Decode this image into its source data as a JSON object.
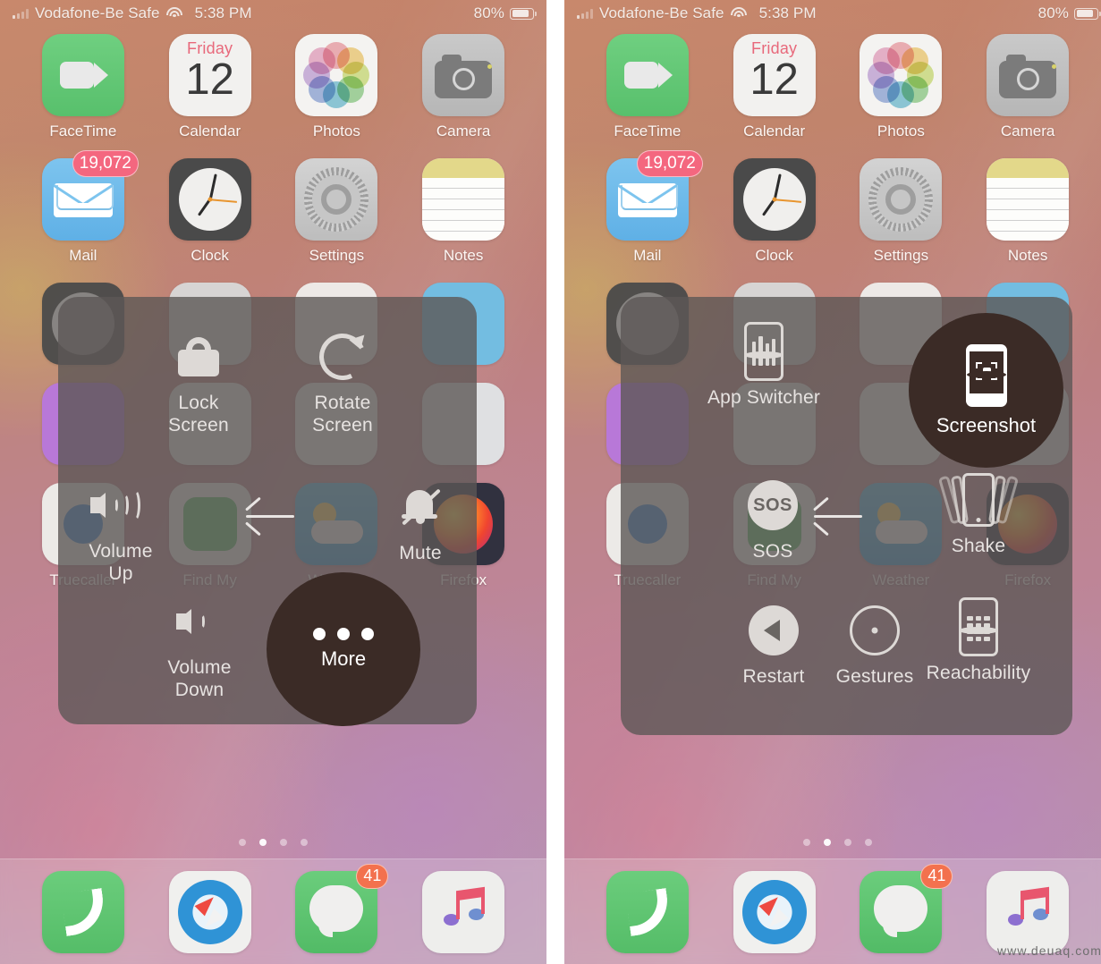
{
  "status_bar": {
    "carrier": "Vodafone-Be Safe",
    "time": "5:38 PM",
    "battery_percent": "80%",
    "wifi_icon": "wifi-icon",
    "signal_icon": "cellular-signal-icon",
    "battery_icon": "battery-icon"
  },
  "home_screen": {
    "apps_row1": [
      {
        "label": "FaceTime",
        "icon": "facetime-icon"
      },
      {
        "label": "Calendar",
        "icon": "calendar-icon",
        "day_of_week": "Friday",
        "day_number": "12"
      },
      {
        "label": "Photos",
        "icon": "photos-icon"
      },
      {
        "label": "Camera",
        "icon": "camera-icon"
      }
    ],
    "apps_row2": [
      {
        "label": "Mail",
        "icon": "mail-icon",
        "badge": "19,072"
      },
      {
        "label": "Clock",
        "icon": "clock-icon"
      },
      {
        "label": "Settings",
        "icon": "settings-icon"
      },
      {
        "label": "Notes",
        "icon": "notes-icon"
      }
    ],
    "apps_row5": [
      {
        "label": "Truecaller",
        "icon": "truecaller-icon"
      },
      {
        "label": "Find My",
        "icon": "find-my-icon"
      },
      {
        "label": "Weather",
        "icon": "weather-icon"
      },
      {
        "label": "Firefox",
        "icon": "firefox-icon"
      }
    ],
    "page_dots": {
      "count": 4,
      "active_index": 1
    },
    "dock": [
      {
        "label": "Phone",
        "icon": "phone-icon"
      },
      {
        "label": "Safari",
        "icon": "safari-icon"
      },
      {
        "label": "Messages",
        "icon": "messages-icon",
        "badge": "41"
      },
      {
        "label": "Music",
        "icon": "music-icon"
      }
    ]
  },
  "left_panel": {
    "items": [
      {
        "label": "Lock Screen",
        "line1": "Lock",
        "line2": "Screen",
        "icon": "lock-icon"
      },
      {
        "label": "Rotate Screen",
        "line1": "Rotate",
        "line2": "Screen",
        "icon": "rotate-icon"
      },
      {
        "label": "Volume Up",
        "line1": "Volume",
        "line2": "Up",
        "icon": "volume-up-icon"
      },
      {
        "label": "Mute",
        "line1": "Mute",
        "line2": "",
        "icon": "mute-bell-icon"
      },
      {
        "label": "Volume Down",
        "line1": "Volume",
        "line2": "Down",
        "icon": "volume-down-icon"
      }
    ],
    "back_icon": "back-arrow-icon",
    "highlight": {
      "label": "More",
      "icon": "ellipsis-icon",
      "color": "#3b2b26"
    }
  },
  "right_panel": {
    "items": [
      {
        "label": "App Switcher",
        "icon": "app-switcher-icon"
      },
      {
        "label": "SOS",
        "icon": "sos-icon",
        "glyph_text": "SOS"
      },
      {
        "label": "Shake",
        "icon": "shake-icon"
      },
      {
        "label": "Restart",
        "icon": "restart-icon"
      },
      {
        "label": "Gestures",
        "icon": "gestures-icon"
      },
      {
        "label": "Reachability",
        "icon": "reachability-icon"
      }
    ],
    "back_icon": "back-arrow-icon",
    "highlight": {
      "label": "Screenshot",
      "icon": "screenshot-icon",
      "color": "#3b2b26"
    }
  },
  "watermark": {
    "text": "www.deuaq.com"
  },
  "colors": {
    "panel_bg": "#5c5856",
    "highlight_bg": "#3b2b26",
    "badge_mail": "#f4677f",
    "badge_messages": "#f3714e",
    "label_text": "#e7e3e1"
  }
}
